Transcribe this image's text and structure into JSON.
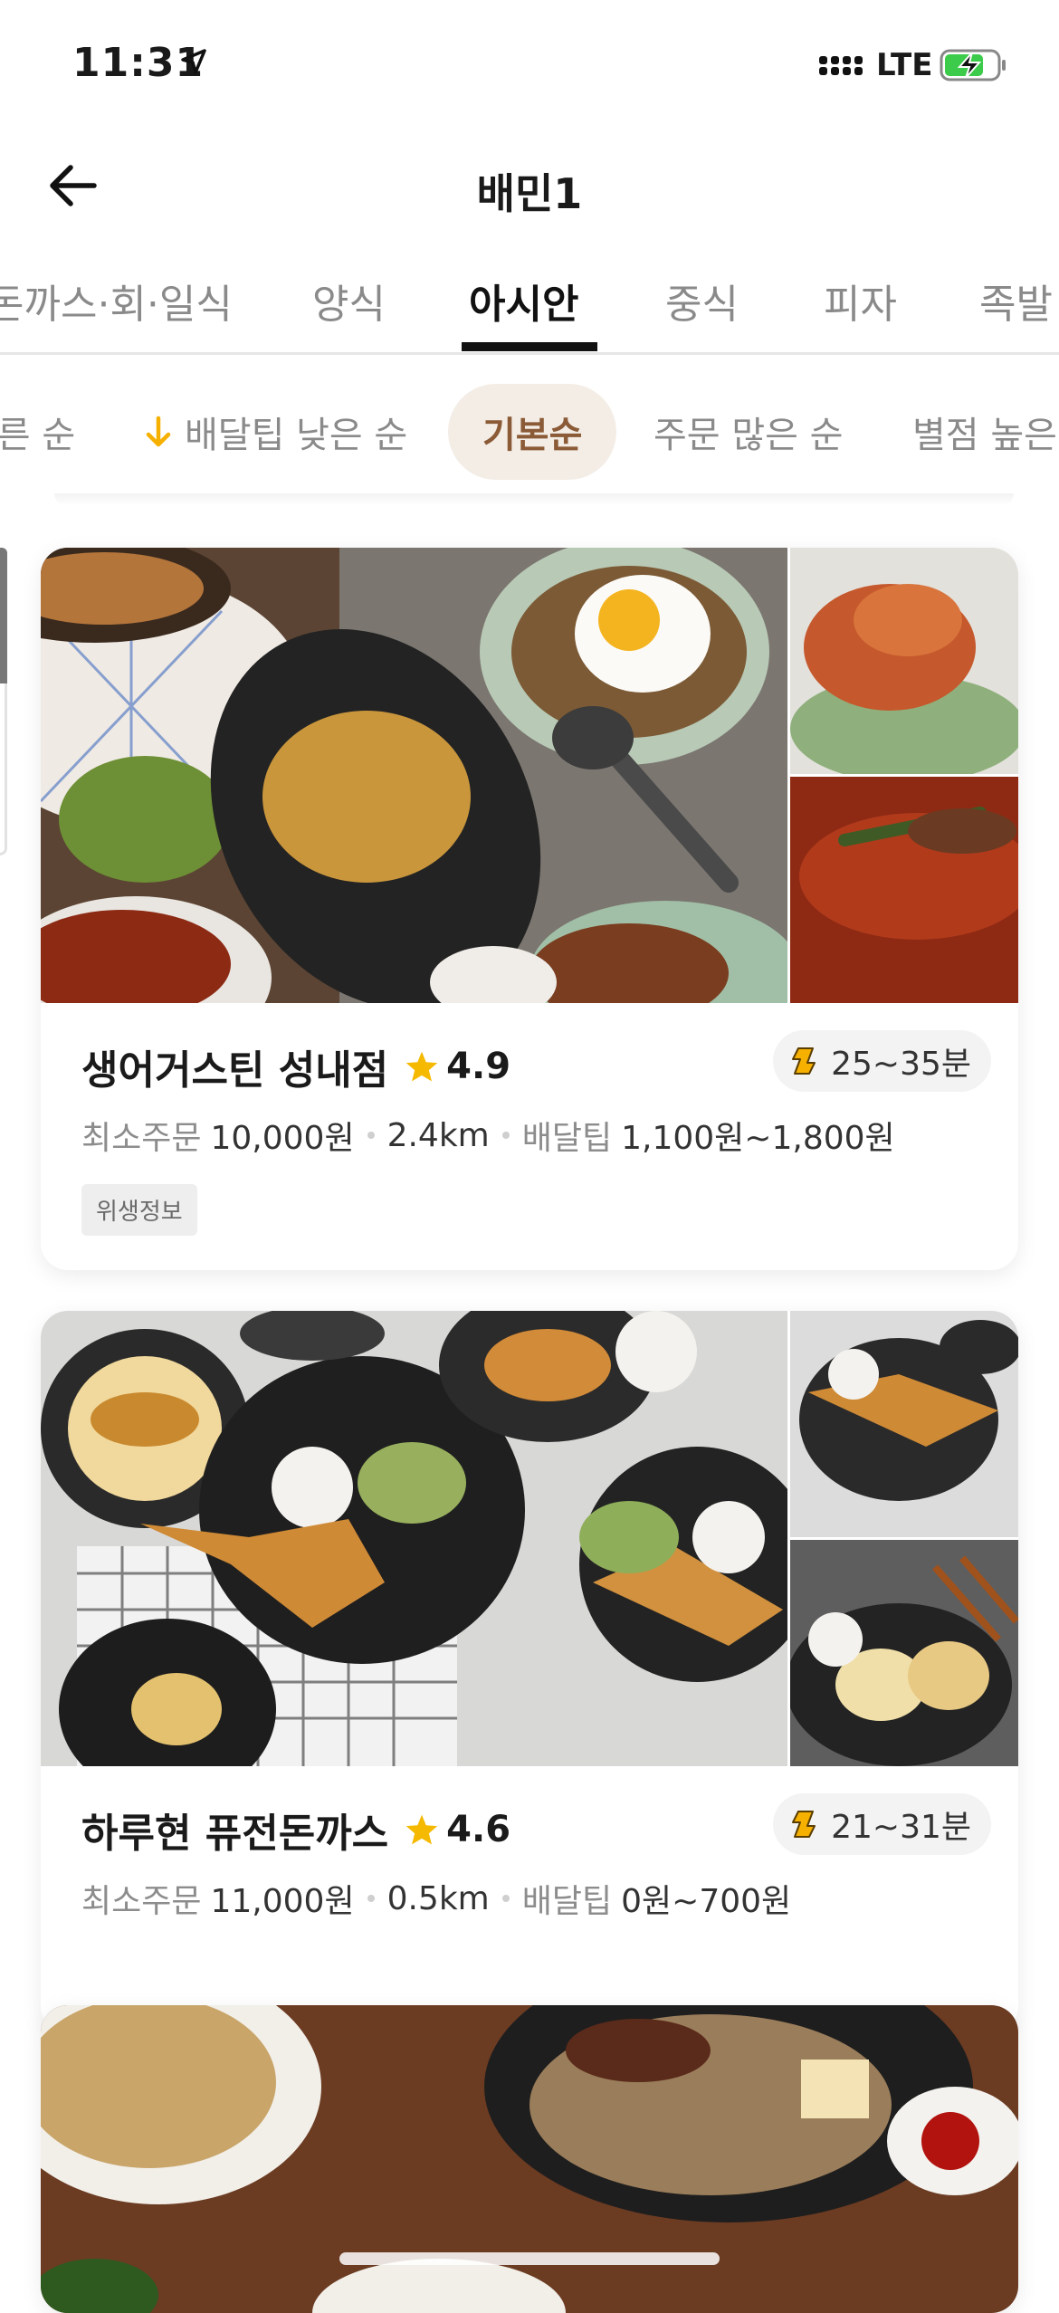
{
  "status_bar": {
    "time": "11:31",
    "network": "LTE",
    "icons": [
      "location-arrow-icon",
      "signal-icon",
      "battery-charging-icon"
    ]
  },
  "header": {
    "title": "배민1",
    "back_icon": "arrow-left-icon"
  },
  "category_tabs": [
    {
      "label": "돈까스·회·일식",
      "active": false
    },
    {
      "label": "양식",
      "active": false
    },
    {
      "label": "아시안",
      "active": true
    },
    {
      "label": "중식",
      "active": false
    },
    {
      "label": "피자",
      "active": false
    },
    {
      "label": "족발",
      "active": false
    }
  ],
  "sort_options": [
    {
      "label": "빠른 순",
      "active": false
    },
    {
      "label": "배달팁 낮은 순",
      "active": false,
      "icon": "arrow-down-icon"
    },
    {
      "label": "기본순",
      "active": true
    },
    {
      "label": "주문 많은 순",
      "active": false
    },
    {
      "label": "별점 높은 순",
      "active": false
    }
  ],
  "restaurants": [
    {
      "name": "생어거스틴 성내점",
      "rating": "4.9",
      "eta": "25~35분",
      "min_order_label": "최소주문",
      "min_order": "10,000원",
      "distance": "2.4km",
      "delivery_tip_label": "배달팁",
      "delivery_tip": "1,100원~1,800원",
      "tag": "위생정보"
    },
    {
      "name": "하루현 퓨전돈까스",
      "rating": "4.6",
      "eta": "21~31분",
      "min_order_label": "최소주문",
      "min_order": "11,000원",
      "distance": "0.5km",
      "delivery_tip_label": "배달팁",
      "delivery_tip": "0원~700원"
    }
  ],
  "colors": {
    "active_chip_bg": "#f3ede6",
    "active_chip_text": "#8b5a36",
    "star": "#f5b900",
    "accent_arrow": "#f5b000"
  }
}
